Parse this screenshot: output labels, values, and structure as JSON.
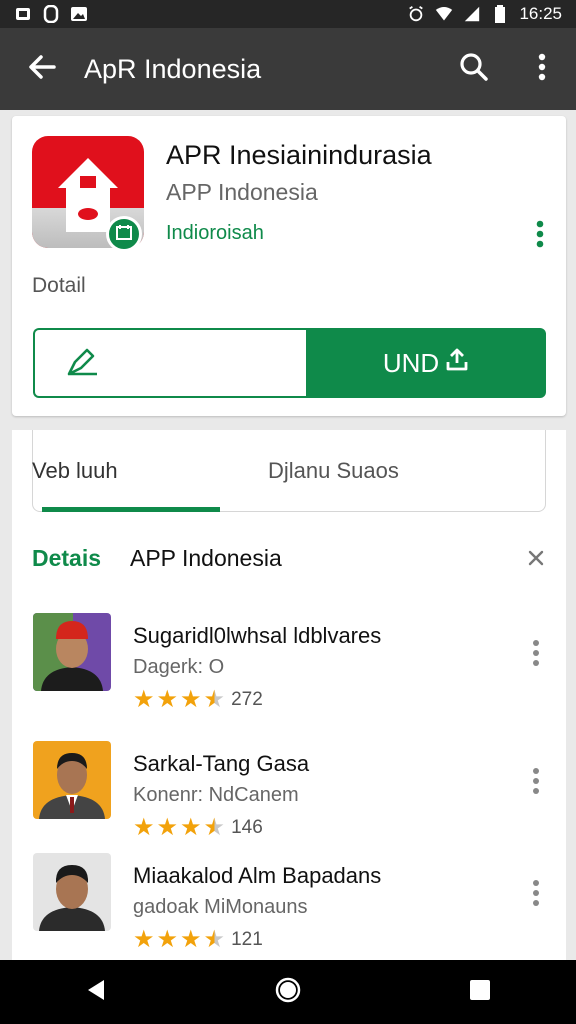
{
  "status_bar": {
    "time": "16:25",
    "left_icons": [
      "sync-icon",
      "sim-icon",
      "image-icon"
    ],
    "right_icons": [
      "alarm-icon",
      "wifi-icon",
      "signal-icon",
      "battery-icon"
    ]
  },
  "app_bar": {
    "title": "ApR Indonesia",
    "back_icon": "arrow-left-icon",
    "search_icon": "search-icon",
    "menu_icon": "more-vertical-icon"
  },
  "app_card": {
    "name": "APR Inesiainindurasia",
    "developer": "APP Indonesia",
    "category": "Indioroisah",
    "detail_label": "Dotail",
    "primary_button_label": "UND",
    "primary_button_icon": "upload-icon",
    "secondary_button_icon": "edit-icon"
  },
  "tabs": [
    {
      "label": "Veb luuh",
      "active": true
    },
    {
      "label": "Djlanu Suaos",
      "active": false
    }
  ],
  "section": {
    "title": "Detais",
    "subtitle": "APP Indonesia"
  },
  "list_items": [
    {
      "name": "Sugaridl0lwhsal ldblvares",
      "subtitle": "Dagerk: O",
      "rating": 3.5,
      "count": "272",
      "avatar_bg": "#6f4aa8"
    },
    {
      "name": "Sarkal-Tang Gasa",
      "subtitle": "Konenr: NdCanem",
      "rating": 3.5,
      "count": "146",
      "avatar_bg": "#f0a21e"
    },
    {
      "name": "Miaakalod Alm Bapadans",
      "subtitle": "gadoak MiMonauns",
      "rating": 3.5,
      "count": "121",
      "avatar_bg": "#e4e4e4"
    }
  ],
  "colors": {
    "accent_green": "#0f8a4a",
    "app_bar": "#3a3a3a",
    "star": "#f2a20b",
    "app_icon_red": "#e0101c"
  },
  "nav_bar": {
    "back_icon": "nav-back-icon",
    "home_icon": "nav-home-icon",
    "recents_icon": "nav-recents-icon"
  }
}
